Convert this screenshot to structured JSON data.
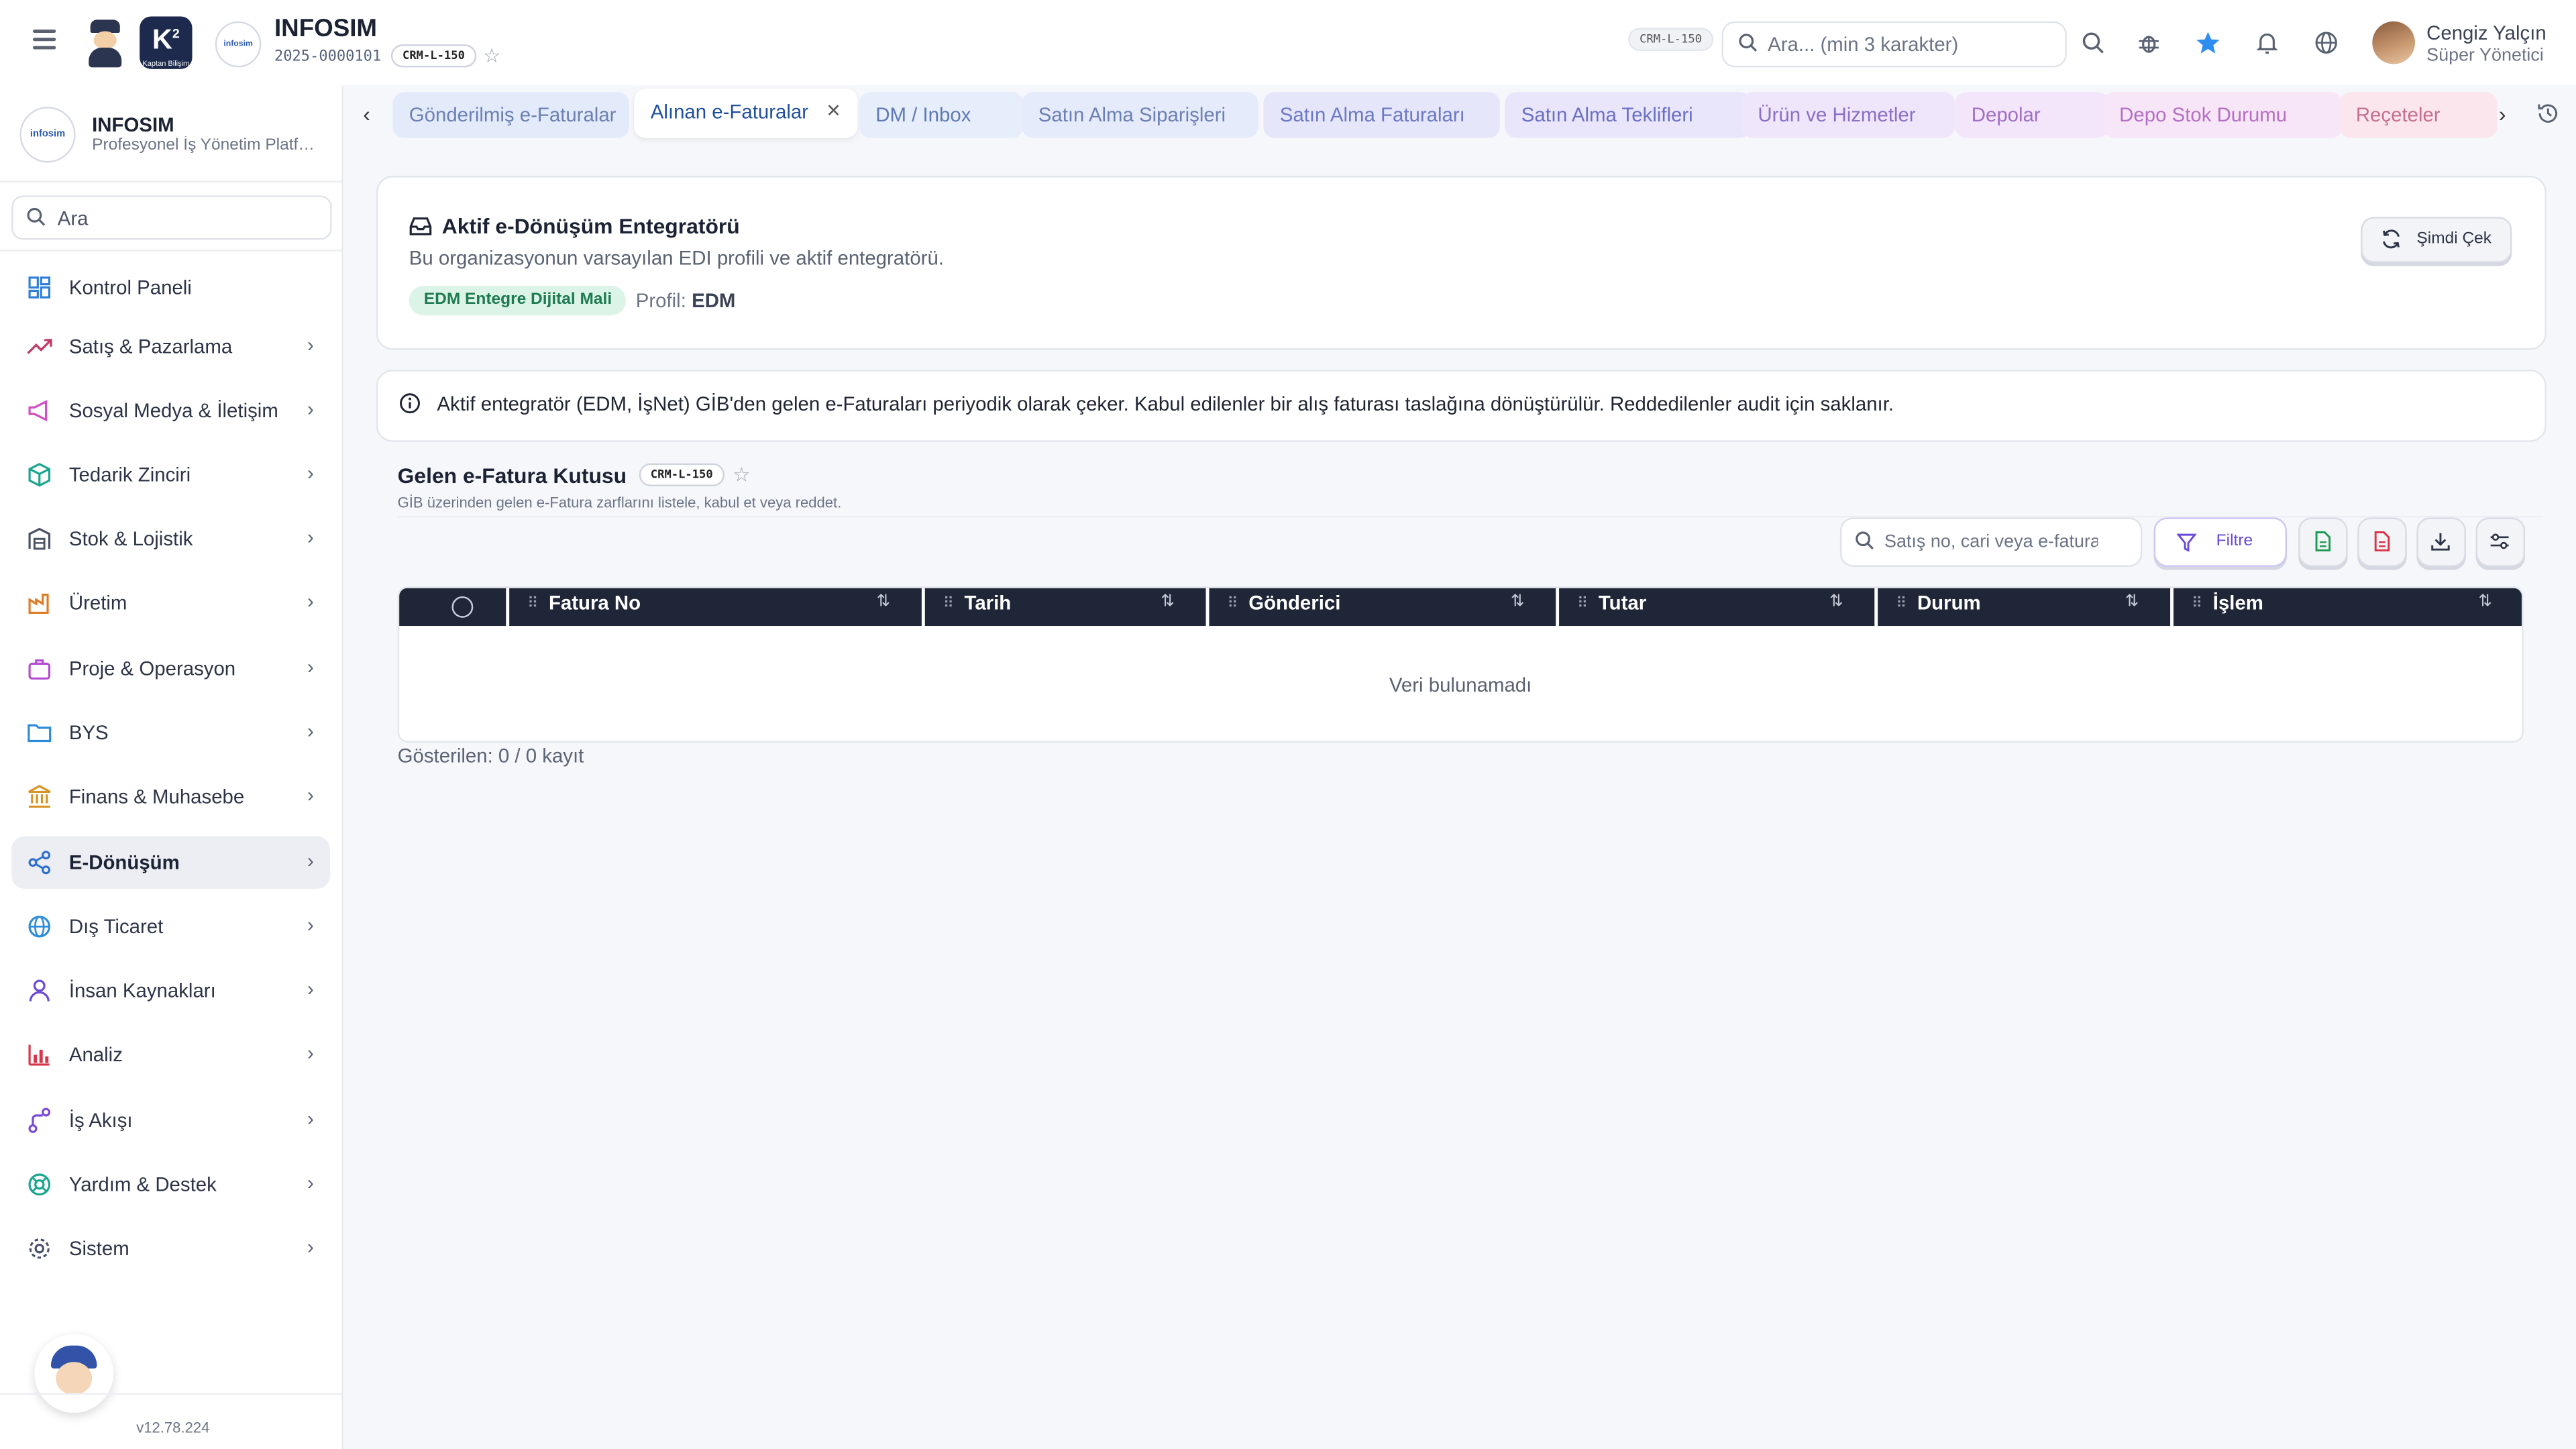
{
  "header": {
    "brand_title": "INFOSIM",
    "brand_code": "2025-0000101",
    "brand_chip": "CRM-L-150",
    "logo2_text": "Kaptan Bilişim",
    "logo3_text": "infosim",
    "top_chip": "CRM-L-150",
    "search_placeholder": "Ara... (min 3 karakter)",
    "user_name": "Cengiz Yalçın",
    "user_role": "Süper Yönetici"
  },
  "sidebar": {
    "title": "INFOSIM",
    "subtitle": "Profesyonel İş Yönetim Platformu",
    "search_placeholder": "Ara",
    "items": [
      {
        "label": "Kontrol Paneli"
      },
      {
        "label": "Satış & Pazarlama"
      },
      {
        "label": "Sosyal Medya & İletişim"
      },
      {
        "label": "Tedarik Zinciri"
      },
      {
        "label": "Stok & Lojistik"
      },
      {
        "label": "Üretim"
      },
      {
        "label": "Proje & Operasyon"
      },
      {
        "label": "BYS"
      },
      {
        "label": "Finans & Muhasebe"
      },
      {
        "label": "E-Dönüşüm"
      },
      {
        "label": "Dış Ticaret"
      },
      {
        "label": "İnsan Kaynakları"
      },
      {
        "label": "Analiz"
      },
      {
        "label": "İş Akışı"
      },
      {
        "label": "Yardım & Destek"
      },
      {
        "label": "Sistem"
      }
    ],
    "version": "v12.78.224"
  },
  "tabs": [
    {
      "label": "Gönderilmiş e-Faturalar",
      "color": "#6b7fb3",
      "bg": "#e3ebfb"
    },
    {
      "label": "Alınan e-Faturalar",
      "color": "#1f4f9c",
      "bg": "#ffffff"
    },
    {
      "label": "DM / Inbox",
      "color": "#5f79b6",
      "bg": "#e6edfb"
    },
    {
      "label": "Satın Alma Siparişleri",
      "color": "#6b7fb3",
      "bg": "#e6ebfb"
    },
    {
      "label": "Satın Alma Faturaları",
      "color": "#6b78c4",
      "bg": "#e6e6fb"
    },
    {
      "label": "Satın Alma Teklifleri",
      "color": "#6b6fc4",
      "bg": "#e9e6fb"
    },
    {
      "label": "Ürün ve Hizmetler",
      "color": "#8a6fc4",
      "bg": "#efe6fb"
    },
    {
      "label": "Depolar",
      "color": "#a06fc4",
      "bg": "#f3e6fb"
    },
    {
      "label": "Depo Stok Durumu",
      "color": "#b46fc4",
      "bg": "#f7e6f7"
    },
    {
      "label": "Reçeteler",
      "color": "#c46f8f",
      "bg": "#fbe6ee"
    }
  ],
  "integrator": {
    "title": "Aktif e-Dönüşüm Entegratörü",
    "description": "Bu organizasyonun varsayılan EDI profili ve aktif entegratörü.",
    "badge": "EDM Entegre Dijital Mali",
    "profile_label": "Profil:",
    "profile_value": "EDM",
    "pull_button": "Şimdi Çek"
  },
  "info_text": "Aktif entegratör (EDM, İşNet) GİB'den gelen e-Faturaları periyodik olarak çeker. Kabul edilenler bir alış faturası taslağına dönüştürülür. Reddedilenler audit için saklanır.",
  "section": {
    "title": "Gelen e-Fatura Kutusu",
    "chip": "CRM-L-150",
    "subtitle": "GİB üzerinden gelen e-Fatura zarflarını listele, kabul et veya reddet.",
    "search_placeholder": "Satış no, cari veya e-fatura no",
    "filter_button": "Filtre"
  },
  "table": {
    "columns": [
      "Fatura No",
      "Tarih",
      "Gönderici",
      "Tutar",
      "Durum",
      "İşlem"
    ],
    "empty_text": "Veri bulunamadı",
    "shown_text": "Gösterilen: 0 / 0 kayıt"
  }
}
